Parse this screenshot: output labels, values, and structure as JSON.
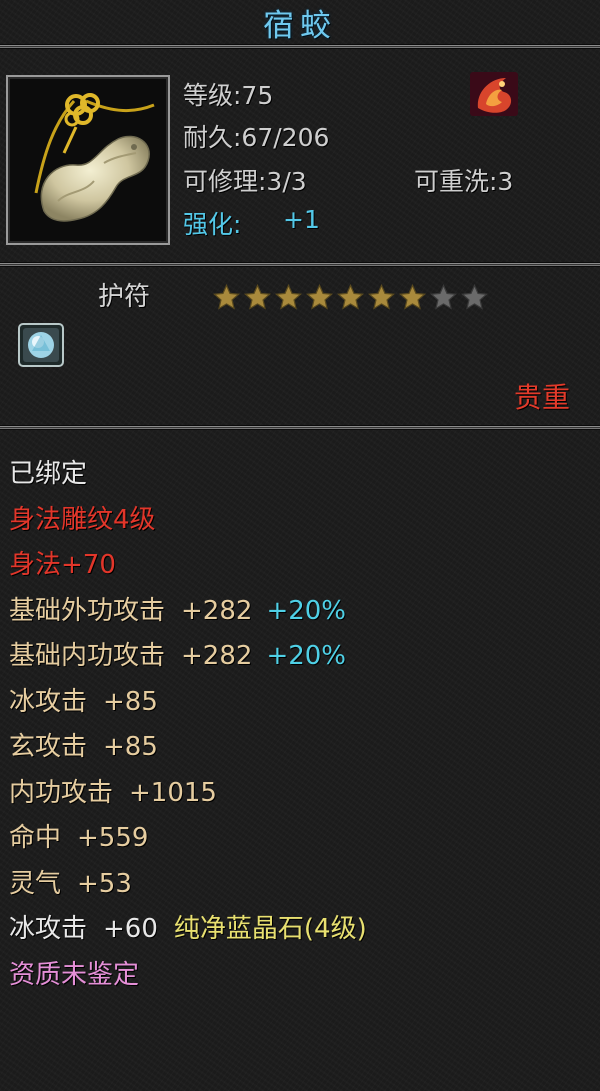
{
  "item": {
    "name": "宿蛟",
    "level_text": "等级:75",
    "durability_text": "耐久:67/206",
    "repair_text": "可修理:3/3",
    "rewash_text": "可重洗:3",
    "enhance_label": "强化:",
    "enhance_value": "+1",
    "type": "护符",
    "star_rating": {
      "filled": 7,
      "total": 9
    },
    "rarity": "贵重",
    "icon": "jade-dragon-pendant-icon",
    "badge_icon": "phoenix-gem-icon",
    "socket_icon": "blue-crystal-socket-icon"
  },
  "attributes": {
    "bound": "已绑定",
    "carving": "身法雕纹4级",
    "agility": "身法+70",
    "ext_attack": {
      "label": "基础外功攻击",
      "value": "+282",
      "bonus": "+20%"
    },
    "int_attack": {
      "label": "基础内功攻击",
      "value": "+282",
      "bonus": "+20%"
    },
    "ice_attack": {
      "label": "冰攻击",
      "value": "+85"
    },
    "mystic_attack": {
      "label": "玄攻击",
      "value": "+85"
    },
    "inner_attack": {
      "label": "内功攻击",
      "value": "+1015"
    },
    "accuracy": {
      "label": "命中",
      "value": "+559"
    },
    "spirit": {
      "label": "灵气",
      "value": "+53"
    },
    "gem_bonus": {
      "label": "冰攻击",
      "value": "+60",
      "gem_name": "纯净蓝晶石(4级)"
    },
    "aptitude": "资质未鉴定"
  },
  "colors": {
    "title": "#6fc9ef",
    "rarity_red": "#e23a2a",
    "attr_gold": "#e6cda0",
    "percent_cyan": "#4fd0e6",
    "gem_yellow": "#e8e070",
    "aptitude_pink": "#e58fd7"
  }
}
